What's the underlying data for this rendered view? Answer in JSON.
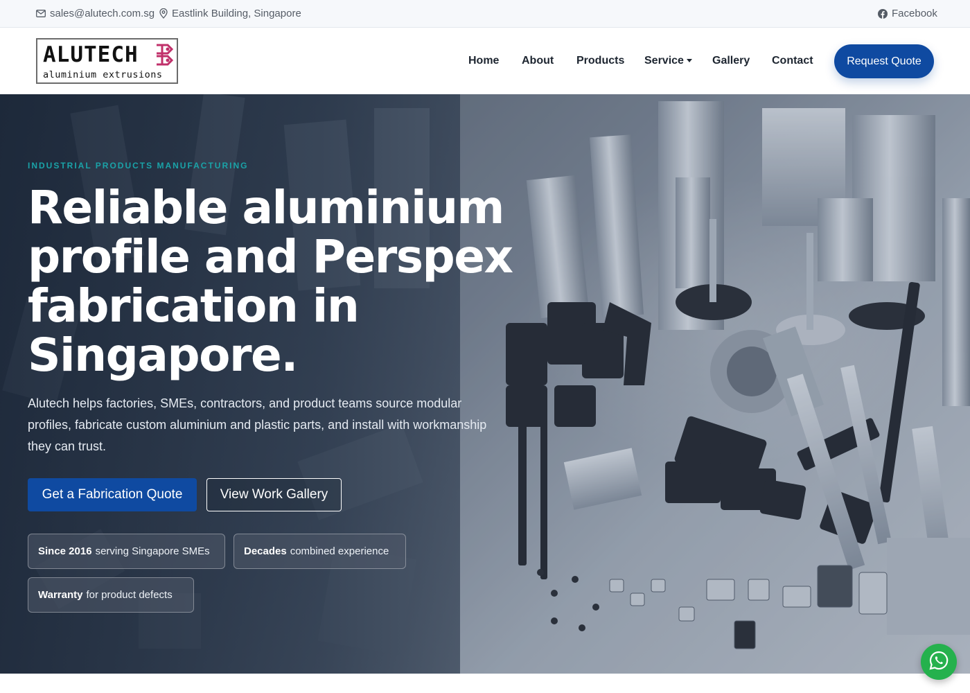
{
  "topbar": {
    "email": "sales@alutech.com.sg",
    "location": "Eastlink Building, Singapore",
    "facebook": "Facebook"
  },
  "logo": {
    "brand": "ALUTECH",
    "tagline": "aluminium extrusions"
  },
  "nav": {
    "items": [
      {
        "label": "Home"
      },
      {
        "label": "About"
      },
      {
        "label": "Products"
      },
      {
        "label": "Service"
      },
      {
        "label": "Gallery"
      },
      {
        "label": "Contact"
      }
    ],
    "quote_button": "Request Quote"
  },
  "hero": {
    "eyebrow": "INDUSTRIAL PRODUCTS MANUFACTURING",
    "headline": "Reliable aluminium profile and Perspex fabrication in Singapore.",
    "lead": "Alutech helps factories, SMEs, contractors, and product teams source modular profiles, fabricate custom aluminium and plastic parts, and install with workmanship they can trust.",
    "primary_button": "Get a Fabrication Quote",
    "secondary_button": "View Work Gallery",
    "chips": [
      {
        "bold": "Since 2016",
        "text": "serving Singapore SMEs"
      },
      {
        "bold": "Decades",
        "text": "combined experience"
      },
      {
        "bold": "Warranty",
        "text": "for product defects"
      }
    ]
  },
  "colors": {
    "primary": "#0f4aa1",
    "eyebrow": "#1aa3a8",
    "whatsapp": "#25b14d",
    "logo_mark": "#c0306a"
  },
  "icons": [
    "envelope-icon",
    "map-pin-icon",
    "facebook-icon",
    "service-caret-icon",
    "whatsapp-icon"
  ]
}
